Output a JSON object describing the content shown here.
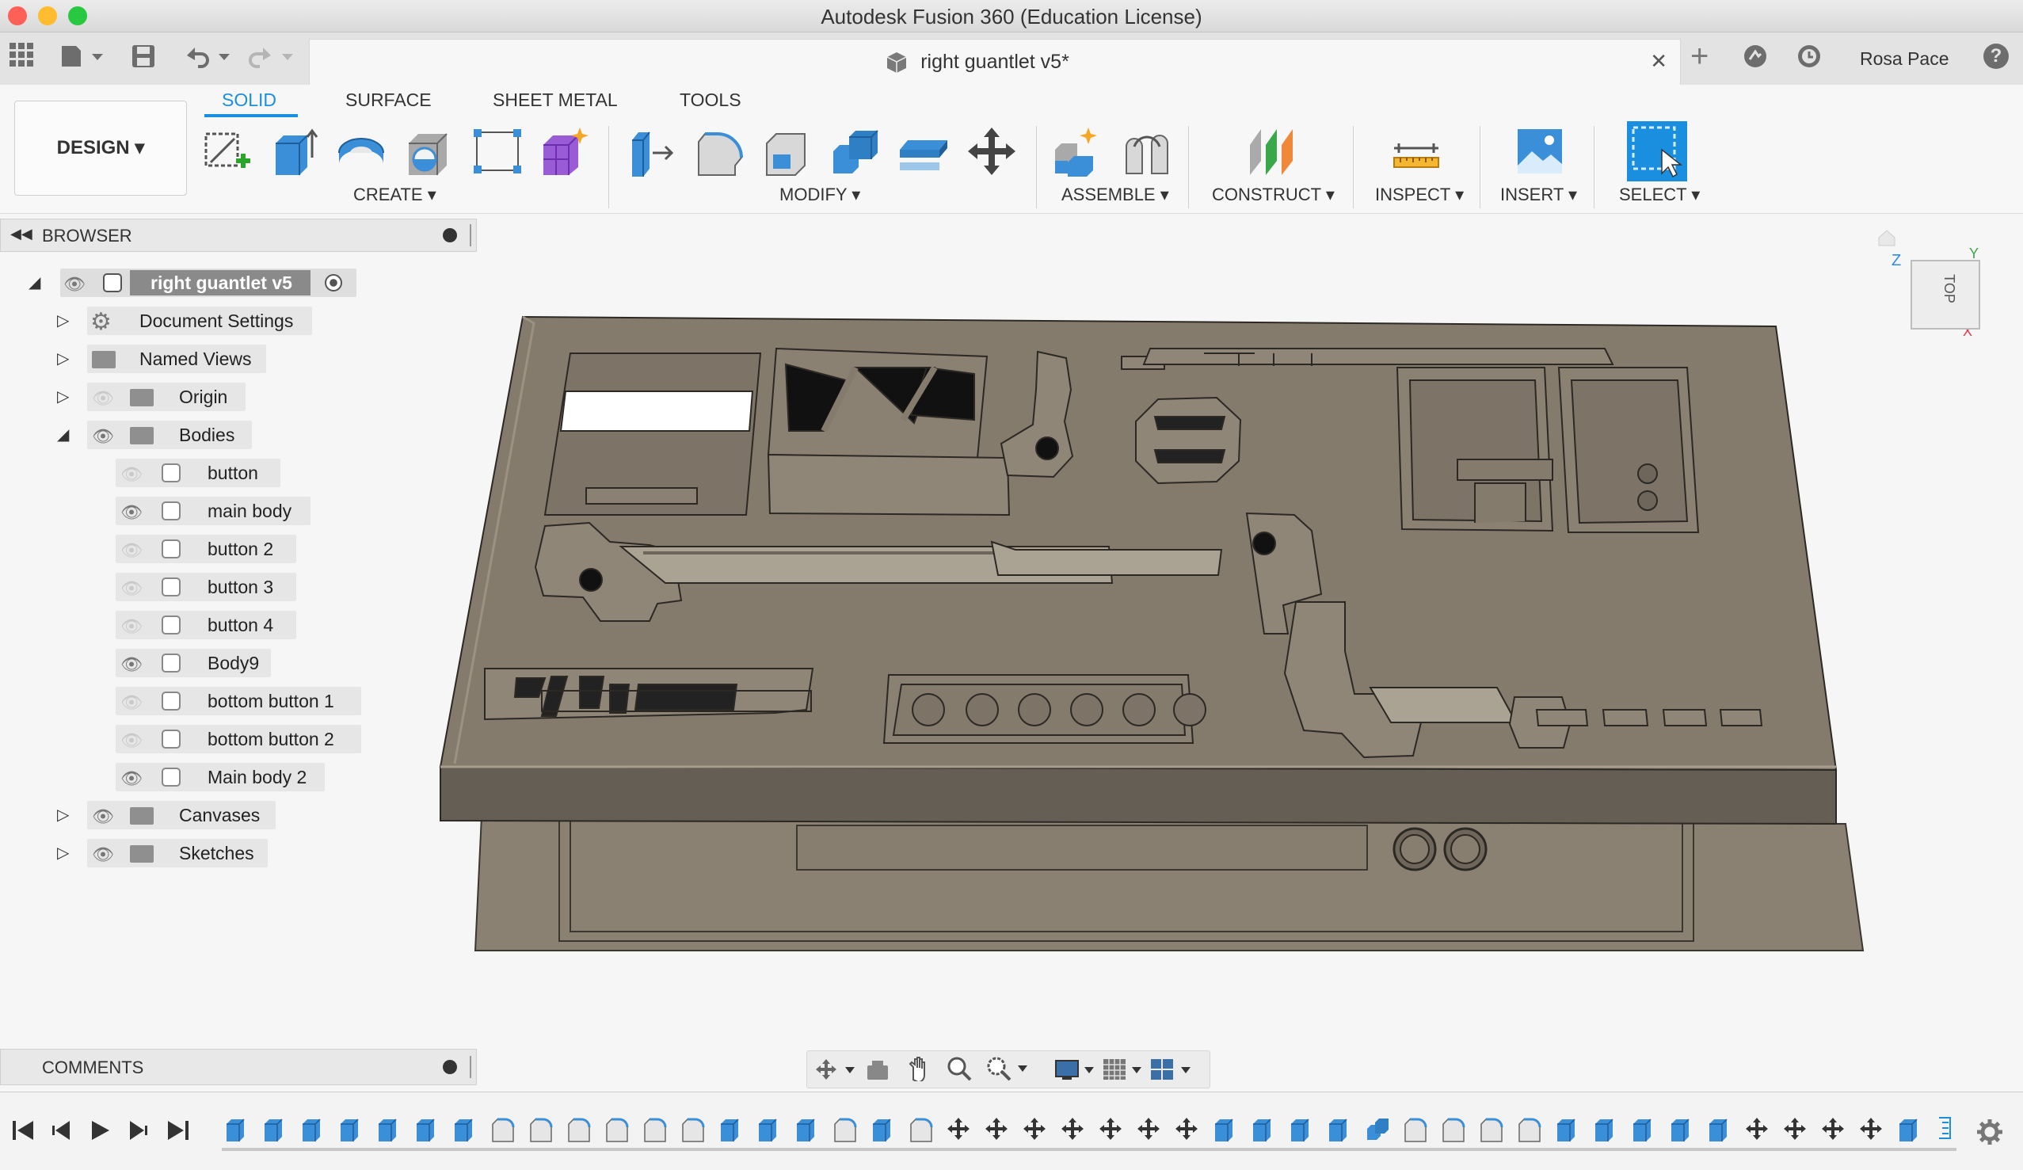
{
  "window": {
    "title": "Autodesk Fusion 360 (Education License)"
  },
  "tabbar": {
    "doc_title": "right guantlet v5*",
    "user": "Rosa Pace",
    "close_glyph": "✕",
    "new_tab_glyph": "+",
    "help_glyph": "?"
  },
  "toolbar": {
    "workspace": "DESIGN ▾",
    "tabs": [
      "SOLID",
      "SURFACE",
      "SHEET METAL",
      "TOOLS"
    ],
    "groups": [
      "CREATE ▾",
      "MODIFY ▾",
      "ASSEMBLE ▾",
      "CONSTRUCT ▾",
      "INSPECT ▾",
      "INSERT ▾",
      "SELECT ▾"
    ]
  },
  "browser": {
    "title": "BROWSER",
    "root": "right guantlet v5",
    "items": [
      "Document Settings",
      "Named Views",
      "Origin",
      "Bodies"
    ],
    "bodies": [
      "button",
      "main body",
      "button 2",
      "button 3",
      "button 4",
      "Body9",
      "bottom button 1",
      "bottom button 2",
      "Main body 2"
    ],
    "after": [
      "Canvases",
      "Sketches"
    ]
  },
  "comments": {
    "title": "COMMENTS"
  },
  "viewcube": {
    "face": "TOP",
    "axis_z": "Z",
    "axis_y": "Y",
    "axis_x": "X"
  },
  "colors": {
    "accent": "#1a8fe0",
    "model": "#857b6d",
    "model_dark": "#5d564d",
    "close_red": "#fe5f57",
    "min_yellow": "#febc2e",
    "max_green": "#28c840"
  }
}
